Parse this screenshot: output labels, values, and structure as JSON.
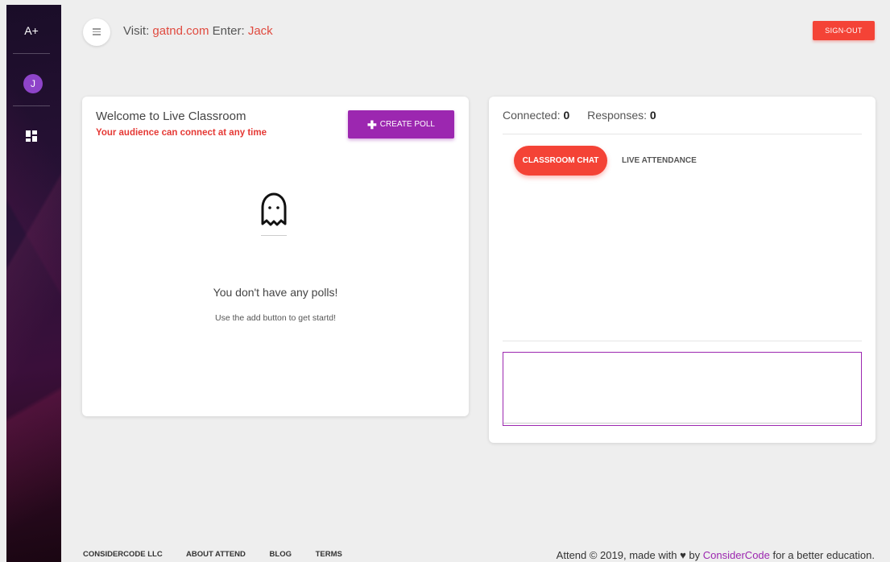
{
  "sidebar": {
    "brand": "A+",
    "avatar_initial": "J"
  },
  "topbar": {
    "visit_label": "Visit:",
    "visit_site": "gatnd.com",
    "enter_label": "Enter:",
    "enter_code": "Jack",
    "signout_label": "SIGN-OUT"
  },
  "polls_card": {
    "title": "Welcome to Live Classroom",
    "subtitle": "Your audience can connect at any time",
    "create_poll_label": "CREATE POLL",
    "empty_title": "You don't have any polls!",
    "empty_hint": "Use the add button to get startd!"
  },
  "live_card": {
    "connected_label": "Connected:",
    "connected_value": "0",
    "responses_label": "Responses:",
    "responses_value": "0",
    "tabs": [
      {
        "label": "CLASSROOM CHAT",
        "active": true
      },
      {
        "label": "LIVE ATTENDANCE",
        "active": false
      }
    ],
    "chat_input_value": ""
  },
  "footer": {
    "links": [
      "CONSIDERCODE LLC",
      "ABOUT ATTEND",
      "BLOG",
      "TERMS"
    ],
    "copyright_prefix": "Attend © 2019, made with",
    "copyright_by": "by",
    "copyright_brand": "ConsiderCode",
    "copyright_suffix": "for a better education."
  },
  "colors": {
    "accent_red": "#f44336",
    "accent_purple": "#9c27b0",
    "avatar": "#8e44c9"
  }
}
